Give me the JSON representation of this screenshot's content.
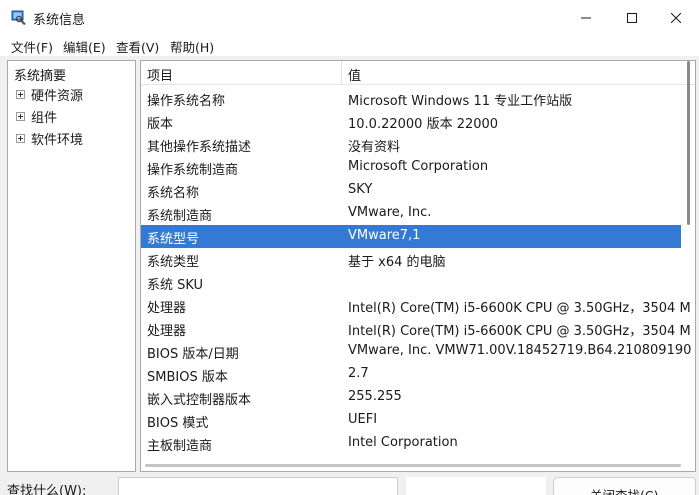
{
  "window": {
    "title": "系统信息",
    "app_icon": "system-info-icon",
    "controls": [
      "minimize-icon",
      "maximize-icon",
      "close-icon"
    ]
  },
  "menu": {
    "file": "文件(F)",
    "edit": "编辑(E)",
    "view": "查看(V)",
    "help": "帮助(H)"
  },
  "tree": {
    "root": "系统摘要",
    "nodes": [
      "硬件资源",
      "组件",
      "软件环境"
    ]
  },
  "list": {
    "headers": {
      "item": "项目",
      "value": "值"
    },
    "selected_row": 6,
    "rows": [
      {
        "item": "操作系统名称",
        "value": "Microsoft Windows 11 专业工作站版"
      },
      {
        "item": "版本",
        "value": "10.0.22000 版本 22000"
      },
      {
        "item": "其他操作系统描述",
        "value": "没有资料"
      },
      {
        "item": "操作系统制造商",
        "value": "Microsoft Corporation"
      },
      {
        "item": "系统名称",
        "value": "SKY"
      },
      {
        "item": "系统制造商",
        "value": "VMware, Inc."
      },
      {
        "item": "系统型号",
        "value": "VMware7,1"
      },
      {
        "item": "系统类型",
        "value": "基于 x64 的电脑"
      },
      {
        "item": "系统 SKU",
        "value": ""
      },
      {
        "item": "处理器",
        "value": "Intel(R) Core(TM) i5-6600K CPU @ 3.50GHz，3504 M"
      },
      {
        "item": "处理器",
        "value": "Intel(R) Core(TM) i5-6600K CPU @ 3.50GHz，3504 M"
      },
      {
        "item": "BIOS 版本/日期",
        "value": "VMware, Inc. VMW71.00V.18452719.B64.210809190"
      },
      {
        "item": "SMBIOS 版本",
        "value": "2.7"
      },
      {
        "item": "嵌入式控制器版本",
        "value": "255.255"
      },
      {
        "item": "BIOS 模式",
        "value": "UEFI"
      },
      {
        "item": "主板制造商",
        "value": "Intel Corporation"
      }
    ]
  },
  "find": {
    "label": "查找什么(W):",
    "value": "",
    "close_button": "关闭查找(C)"
  },
  "colors": {
    "selection": "#3479d4",
    "window_bg": "#f0f0f0"
  }
}
